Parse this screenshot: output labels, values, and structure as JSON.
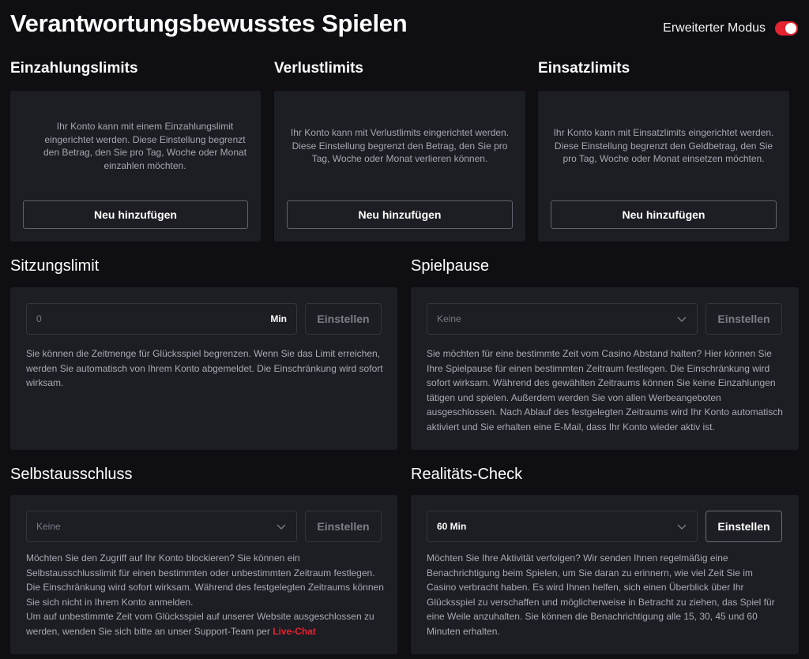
{
  "header": {
    "title": "Verantwortungsbewusstes Spielen",
    "advanced_mode_label": "Erweiterter Modus",
    "advanced_mode_on": true,
    "toggle_color": "#e3232f"
  },
  "deposit": {
    "title": "Einzahlungslimits",
    "description": "Ihr Konto kann mit einem Einzahlungslimit eingerichtet werden. Diese Einstellung begrenzt den Betrag, den Sie pro Tag, Woche oder Monat einzahlen möchten.",
    "button": "Neu hinzufügen"
  },
  "loss": {
    "title": "Verlustlimits",
    "description": "Ihr Konto kann mit Verlustlimits eingerichtet werden. Diese Einstellung begrenzt den Betrag, den Sie pro Tag, Woche oder Monat verlieren können.",
    "button": "Neu hinzufügen"
  },
  "wager": {
    "title": "Einsatzlimits",
    "description": "Ihr Konto kann mit Einsatzlimits eingerichtet werden. Diese Einstellung begrenzt den Geldbetrag, den Sie pro Tag, Woche oder Monat einsetzen möchten.",
    "button": "Neu hinzufügen"
  },
  "session": {
    "title": "Sitzungslimit",
    "input_value": "0",
    "unit": "Min",
    "button": "Einstellen",
    "description": "Sie können die Zeitmenge für Glücksspiel begrenzen. Wenn Sie das Limit erreichen, werden Sie automatisch von Ihrem Konto abgemeldet. Die Einschränkung wird sofort wirksam."
  },
  "break": {
    "title": "Spielpause",
    "select_value": "Keine",
    "button": "Einstellen",
    "description": "Sie möchten für eine bestimmte Zeit vom Casino Abstand halten? Hier können Sie Ihre Spielpause für einen bestimmten Zeitraum festlegen. Die Einschränkung wird sofort wirksam. Während des gewählten Zeitraums können Sie keine Einzahlungen tätigen und spielen. Außerdem werden Sie von allen Werbeangeboten ausgeschlossen. Nach Ablauf des festgelegten Zeitraums wird Ihr Konto automatisch aktiviert und Sie erhalten eine E-Mail, dass Ihr Konto wieder aktiv ist."
  },
  "exclusion": {
    "title": "Selbstausschluss",
    "select_value": "Keine",
    "button": "Einstellen",
    "description": "Möchten Sie den Zugriff auf Ihr Konto blockieren? Sie können ein Selbstausschlusslimit für einen bestimmten oder unbestimmten Zeitraum festlegen. Die Einschränkung wird sofort wirksam. Während des festgelegten Zeitraums können Sie sich nicht in Ihrem Konto anmelden.",
    "description2": "Um auf unbestimmte Zeit vom Glücksspiel auf unserer Website ausgeschlossen zu werden, wenden Sie sich bitte an unser Support-Team per",
    "link": "Live-Chat"
  },
  "reality": {
    "title": "Realitäts-Check",
    "select_value": "60 Min",
    "button": "Einstellen",
    "description": "Möchten Sie Ihre Aktivität verfolgen? Wir senden Ihnen regelmäßig eine Benachrichtigung beim Spielen, um Sie daran zu erinnern, wie viel Zeit Sie im Casino verbracht haben. Es wird Ihnen helfen, sich einen Überblick über Ihr Glücksspiel zu verschaffen und möglicherweise in Betracht zu ziehen, das Spiel für eine Weile anzuhalten. Sie können die Benachrichtigung alle 15, 30, 45 und 60 Minuten erhalten."
  }
}
